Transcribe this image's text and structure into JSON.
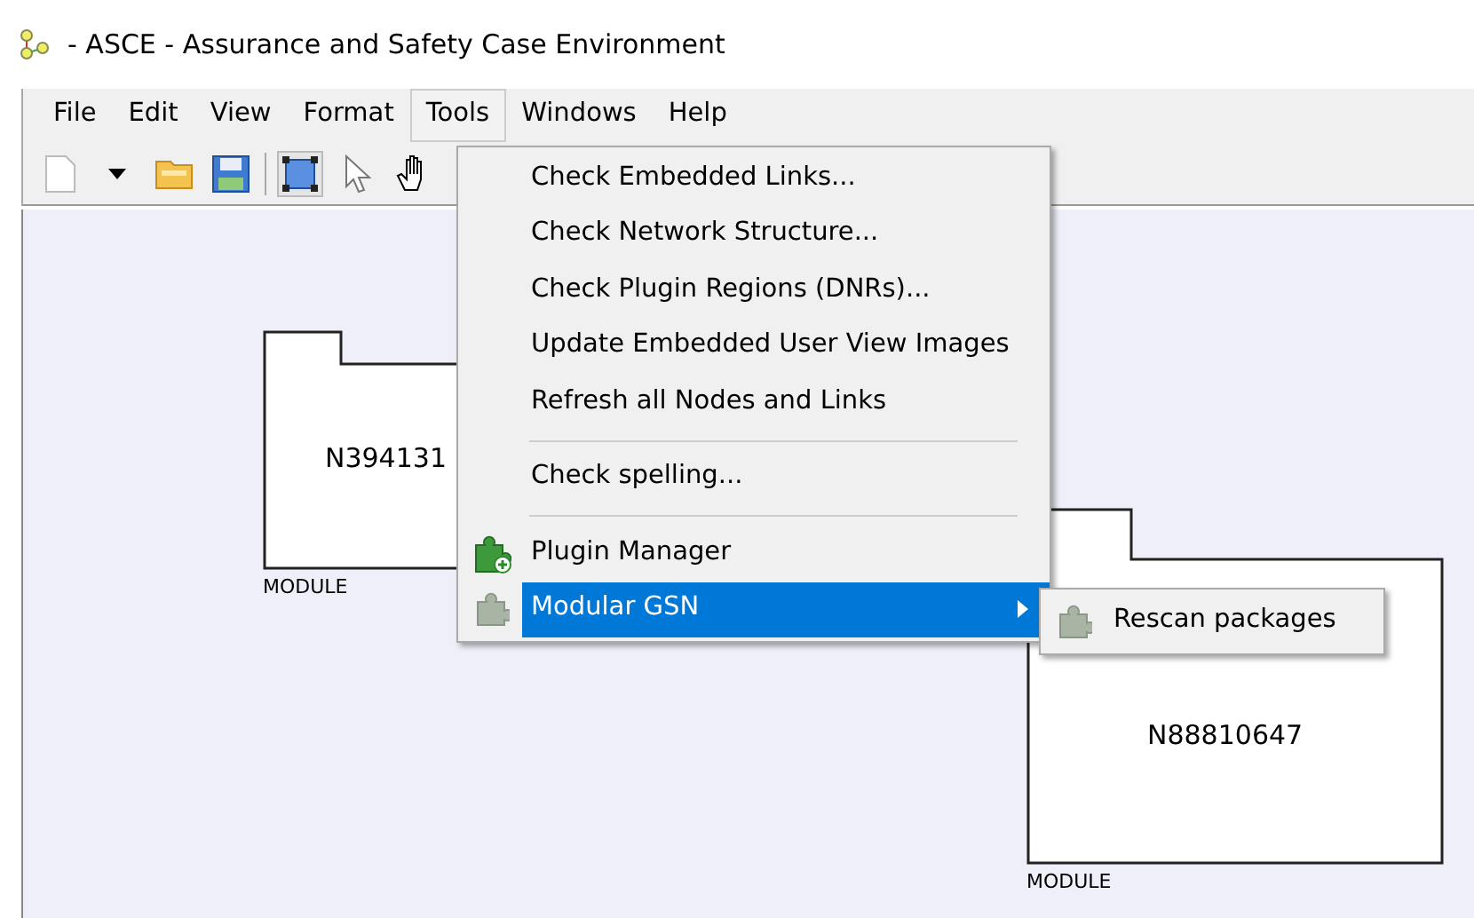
{
  "window": {
    "title": "- ASCE - Assurance and Safety Case Environment"
  },
  "menu_bar": [
    {
      "label": "File",
      "selected": false
    },
    {
      "label": "Edit",
      "selected": false
    },
    {
      "label": "View",
      "selected": false
    },
    {
      "label": "Format",
      "selected": false
    },
    {
      "label": "Tools",
      "selected": true
    },
    {
      "label": "Windows",
      "selected": false
    },
    {
      "label": "Help",
      "selected": false
    }
  ],
  "toolbar": [
    {
      "kind": "new"
    },
    {
      "kind": "caret"
    },
    {
      "kind": "open"
    },
    {
      "kind": "save"
    },
    {
      "kind": "separator"
    },
    {
      "kind": "select",
      "pressed": true
    },
    {
      "kind": "pointer",
      "pressed": false
    },
    {
      "kind": "hand",
      "pressed": false
    }
  ],
  "canvas": {
    "nodes": [
      {
        "label": "N394131",
        "type": "MODULE"
      },
      {
        "label": "N88810647",
        "type": "MODULE"
      }
    ]
  },
  "tools_menu": [
    {
      "kind": "item",
      "label": "Check Embedded Links...",
      "selected": false
    },
    {
      "kind": "item",
      "label": "Check Network Structure...",
      "selected": false
    },
    {
      "kind": "item",
      "label": "Check Plugin Regions (DNRs)...",
      "selected": false
    },
    {
      "kind": "item",
      "label": "Update Embedded User View Images",
      "selected": false
    },
    {
      "kind": "item",
      "label": "Refresh all Nodes and Links",
      "selected": false
    },
    {
      "kind": "separator"
    },
    {
      "kind": "item",
      "label": "Check spelling...",
      "selected": false
    },
    {
      "kind": "separator"
    },
    {
      "kind": "plugin-item",
      "label": "Plugin Manager",
      "selected": false
    },
    {
      "kind": "submenu",
      "label": "Modular GSN",
      "selected": true
    }
  ],
  "submenu": [
    {
      "label": "Rescan packages"
    }
  ]
}
